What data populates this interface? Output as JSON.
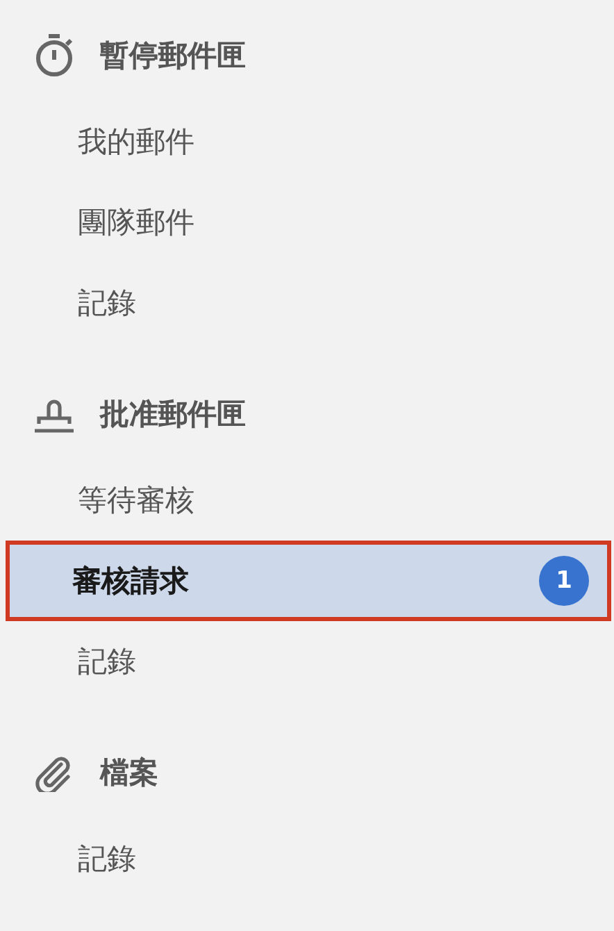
{
  "sections": [
    {
      "title": "暫停郵件匣",
      "items": [
        {
          "label": "我的郵件",
          "selected": false
        },
        {
          "label": "團隊郵件",
          "selected": false
        },
        {
          "label": "記錄",
          "selected": false
        }
      ]
    },
    {
      "title": "批准郵件匣",
      "items": [
        {
          "label": "等待審核",
          "selected": false
        },
        {
          "label": "審核請求",
          "selected": true,
          "badge": "1"
        },
        {
          "label": "記錄",
          "selected": false
        }
      ]
    },
    {
      "title": "檔案",
      "items": [
        {
          "label": "記錄",
          "selected": false
        }
      ]
    }
  ]
}
